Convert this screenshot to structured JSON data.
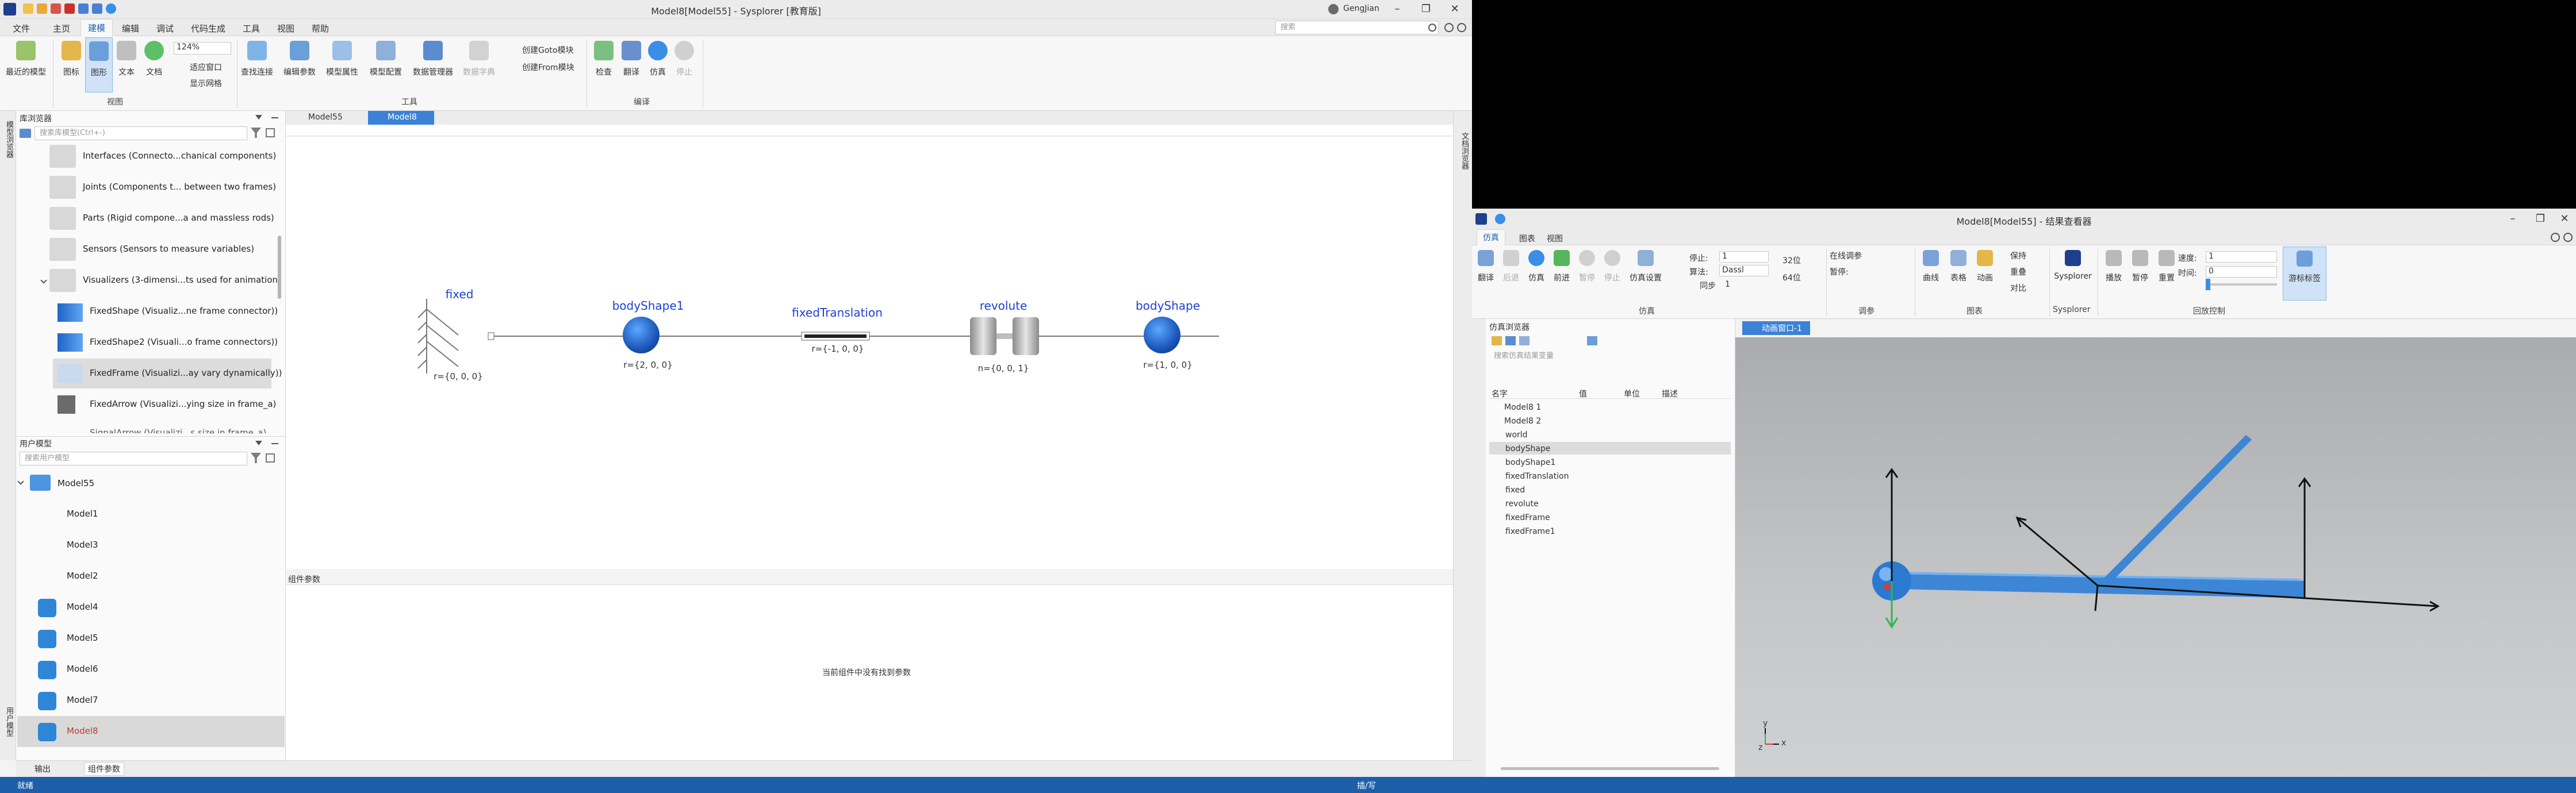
{
  "main_window": {
    "title": "Model8[Model55] - Sysplorer [教育版]",
    "user": "GengJian",
    "menu": [
      "文件",
      "主页",
      "建模",
      "编辑",
      "调试",
      "代码生成",
      "工具",
      "视图",
      "帮助"
    ],
    "active_menu": "建模",
    "search_placeholder": "搜索",
    "ribbon": {
      "buttons": [
        "最近的模型",
        "图标",
        "图形",
        "文本",
        "文档",
        "查找连接",
        "编辑参数",
        "模型属性",
        "模型配置",
        "数据管理器",
        "数据字典",
        "检查",
        "翻译",
        "仿真",
        "停止"
      ],
      "zoom": "124%",
      "fit_window": "适应窗口",
      "show_grid": "显示网格",
      "create_goto": "创建Goto模块",
      "create_from": "创建From模块",
      "groups": [
        "视图",
        "工具",
        "编译"
      ]
    },
    "library": {
      "title": "库浏览器",
      "search_placeholder": "搜索库模型(Ctrl+-)",
      "items": [
        "Interfaces (Connecto...chanical components)",
        "Joints (Components t... between two frames)",
        "Parts (Rigid compone...a and massless rods)",
        "Sensors (Sensors to measure variables)",
        "Visualizers (3-dimensi...ts used for animation)",
        "FixedShape (Visualiz...ne frame connector))",
        "FixedShape2 (Visuali...o frame connectors))",
        "FixedFrame (Visualizi...ay vary dynamically))",
        "FixedArrow (Visualizi...ying size in frame_a)",
        "SignalArrow (Visualizi...s size in frame_a)"
      ]
    },
    "user_models": {
      "title": "用户模型",
      "search_placeholder": "搜索用户模型",
      "root": "Model55",
      "items": [
        "Model1",
        "Model3",
        "Model2",
        "Model4",
        "Model5",
        "Model6",
        "Model7",
        "Model8"
      ]
    },
    "tabs": [
      "Model55",
      "Model8"
    ],
    "diagram": {
      "components": [
        {
          "name": "fixed",
          "param": "r={0, 0, 0}"
        },
        {
          "name": "bodyShape1",
          "param": "r={2, 0, 0}"
        },
        {
          "name": "fixedTranslation",
          "param": "r={-1, 0, 0}"
        },
        {
          "name": "revolute",
          "param": "n={0, 0, 1}"
        },
        {
          "name": "bodyShape",
          "param": "r={1, 0, 0}"
        }
      ]
    },
    "params_panel": {
      "title": "组件参数",
      "empty": "当前组件中没有找到参数"
    },
    "bottom_tabs": [
      "输出",
      "组件参数"
    ],
    "side_tabs": {
      "left_top": "模型浏览器",
      "left_bottom": "用户模型",
      "right": "文档浏览器"
    }
  },
  "status": {
    "left": "就绪",
    "center": "插/写"
  },
  "result_window": {
    "title": "Model8[Model55] - 结果查看器",
    "menu": [
      "仿真",
      "图表",
      "视图"
    ],
    "ribbon": {
      "buttons": [
        "翻译",
        "后退",
        "仿真",
        "前进",
        "暂停",
        "停止",
        "仿真设置",
        "曲线",
        "表格",
        "动画",
        "Sysplorer",
        "播放",
        "暂停",
        "重置",
        "游标标签"
      ],
      "stop_label": "停止:",
      "stop_value": "1",
      "algo_label": "算法:",
      "algo_value": "Dassl",
      "step_label": "步长:",
      "step_value": "1",
      "sync": "同步",
      "bit32": "32位",
      "bit64": "64位",
      "online": "在线调参",
      "pause_label": "暂停:",
      "keep": "保持",
      "overlay": "重叠",
      "compare": "对比",
      "speed_label": "速度:",
      "speed_value": "1",
      "time_label": "时间:",
      "time_value": "0",
      "groups": [
        "仿真",
        "调参",
        "图表",
        "Sysplorer",
        "回放控制"
      ]
    },
    "browser": {
      "title": "仿真浏览器",
      "search_placeholder": "搜索仿真结果变量",
      "columns": [
        "名字",
        "值",
        "单位",
        "描述"
      ],
      "roots": [
        "Model8 1",
        "Model8 2"
      ],
      "children": [
        "world",
        "bodyShape",
        "bodyShape1",
        "fixedTranslation",
        "fixed",
        "revolute",
        "fixedFrame",
        "fixedFrame1"
      ],
      "selected": "bodyShape"
    },
    "view_tab": "动画窗口-1",
    "axes": {
      "x": "x",
      "y": "y",
      "z": "z"
    }
  }
}
